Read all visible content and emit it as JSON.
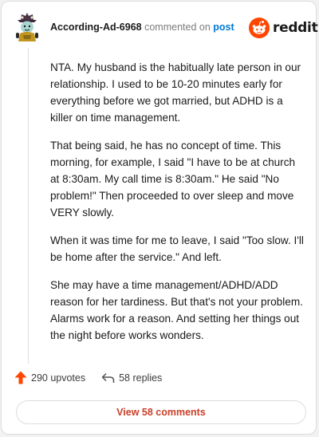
{
  "header": {
    "username": "According-Ad-6968",
    "commented_text": "commented on",
    "post_link": "post",
    "brand": "reddit"
  },
  "comment": {
    "paragraphs": [
      "NTA. My husband is the habitually late person in our relationship. I used to be 10-20 minutes early for everything before we got married, but ADHD is a killer on time management.",
      "That being said, he has no concept of time. This morning, for example, I said \"I have to be at church at 8:30am. My call time is 8:30am.\" He said \"No problem!\" Then proceeded to over sleep and move VERY slowly.",
      "When it was time for me to leave, I said \"Too slow. I'll be home after the service.\" And left.",
      "She may have a time management/ADHD/ADD reason for her tardiness. But that's not your problem. Alarms work for a reason. And setting her things out the night before works wonders."
    ]
  },
  "actions": {
    "upvotes": "290 upvotes",
    "replies": "58 replies"
  },
  "view_button": "View 58 comments",
  "colors": {
    "accent": "#c8412a",
    "upvote": "#ff4500",
    "link": "#0079d3",
    "brand": "#ff4500"
  },
  "icons": [
    "avatar-icon",
    "reddit-logo-icon",
    "upvote-arrow-icon",
    "reply-arrow-icon"
  ]
}
